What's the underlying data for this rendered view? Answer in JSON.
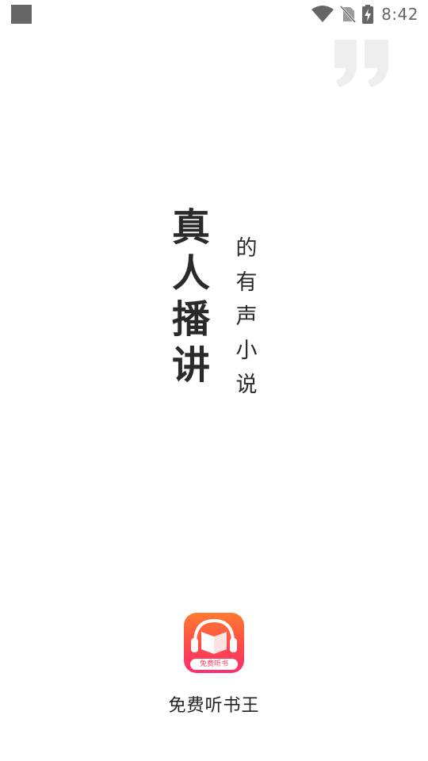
{
  "status_bar": {
    "time": "8:42",
    "icons": [
      "notification-square-icon",
      "wifi-icon",
      "no-sim-icon",
      "battery-charging-icon"
    ],
    "icon_color": "#666666"
  },
  "slogan": {
    "main_chars": [
      "真",
      "人",
      "播",
      "讲"
    ],
    "sub_chars": [
      "的",
      "有",
      "声",
      "小",
      "说"
    ],
    "quote_color": "#eeeeee"
  },
  "app": {
    "icon_label": "免费听书",
    "name": "免费听书王",
    "gradient_top": "#ff7a2f",
    "gradient_bottom": "#ff2d6e"
  }
}
